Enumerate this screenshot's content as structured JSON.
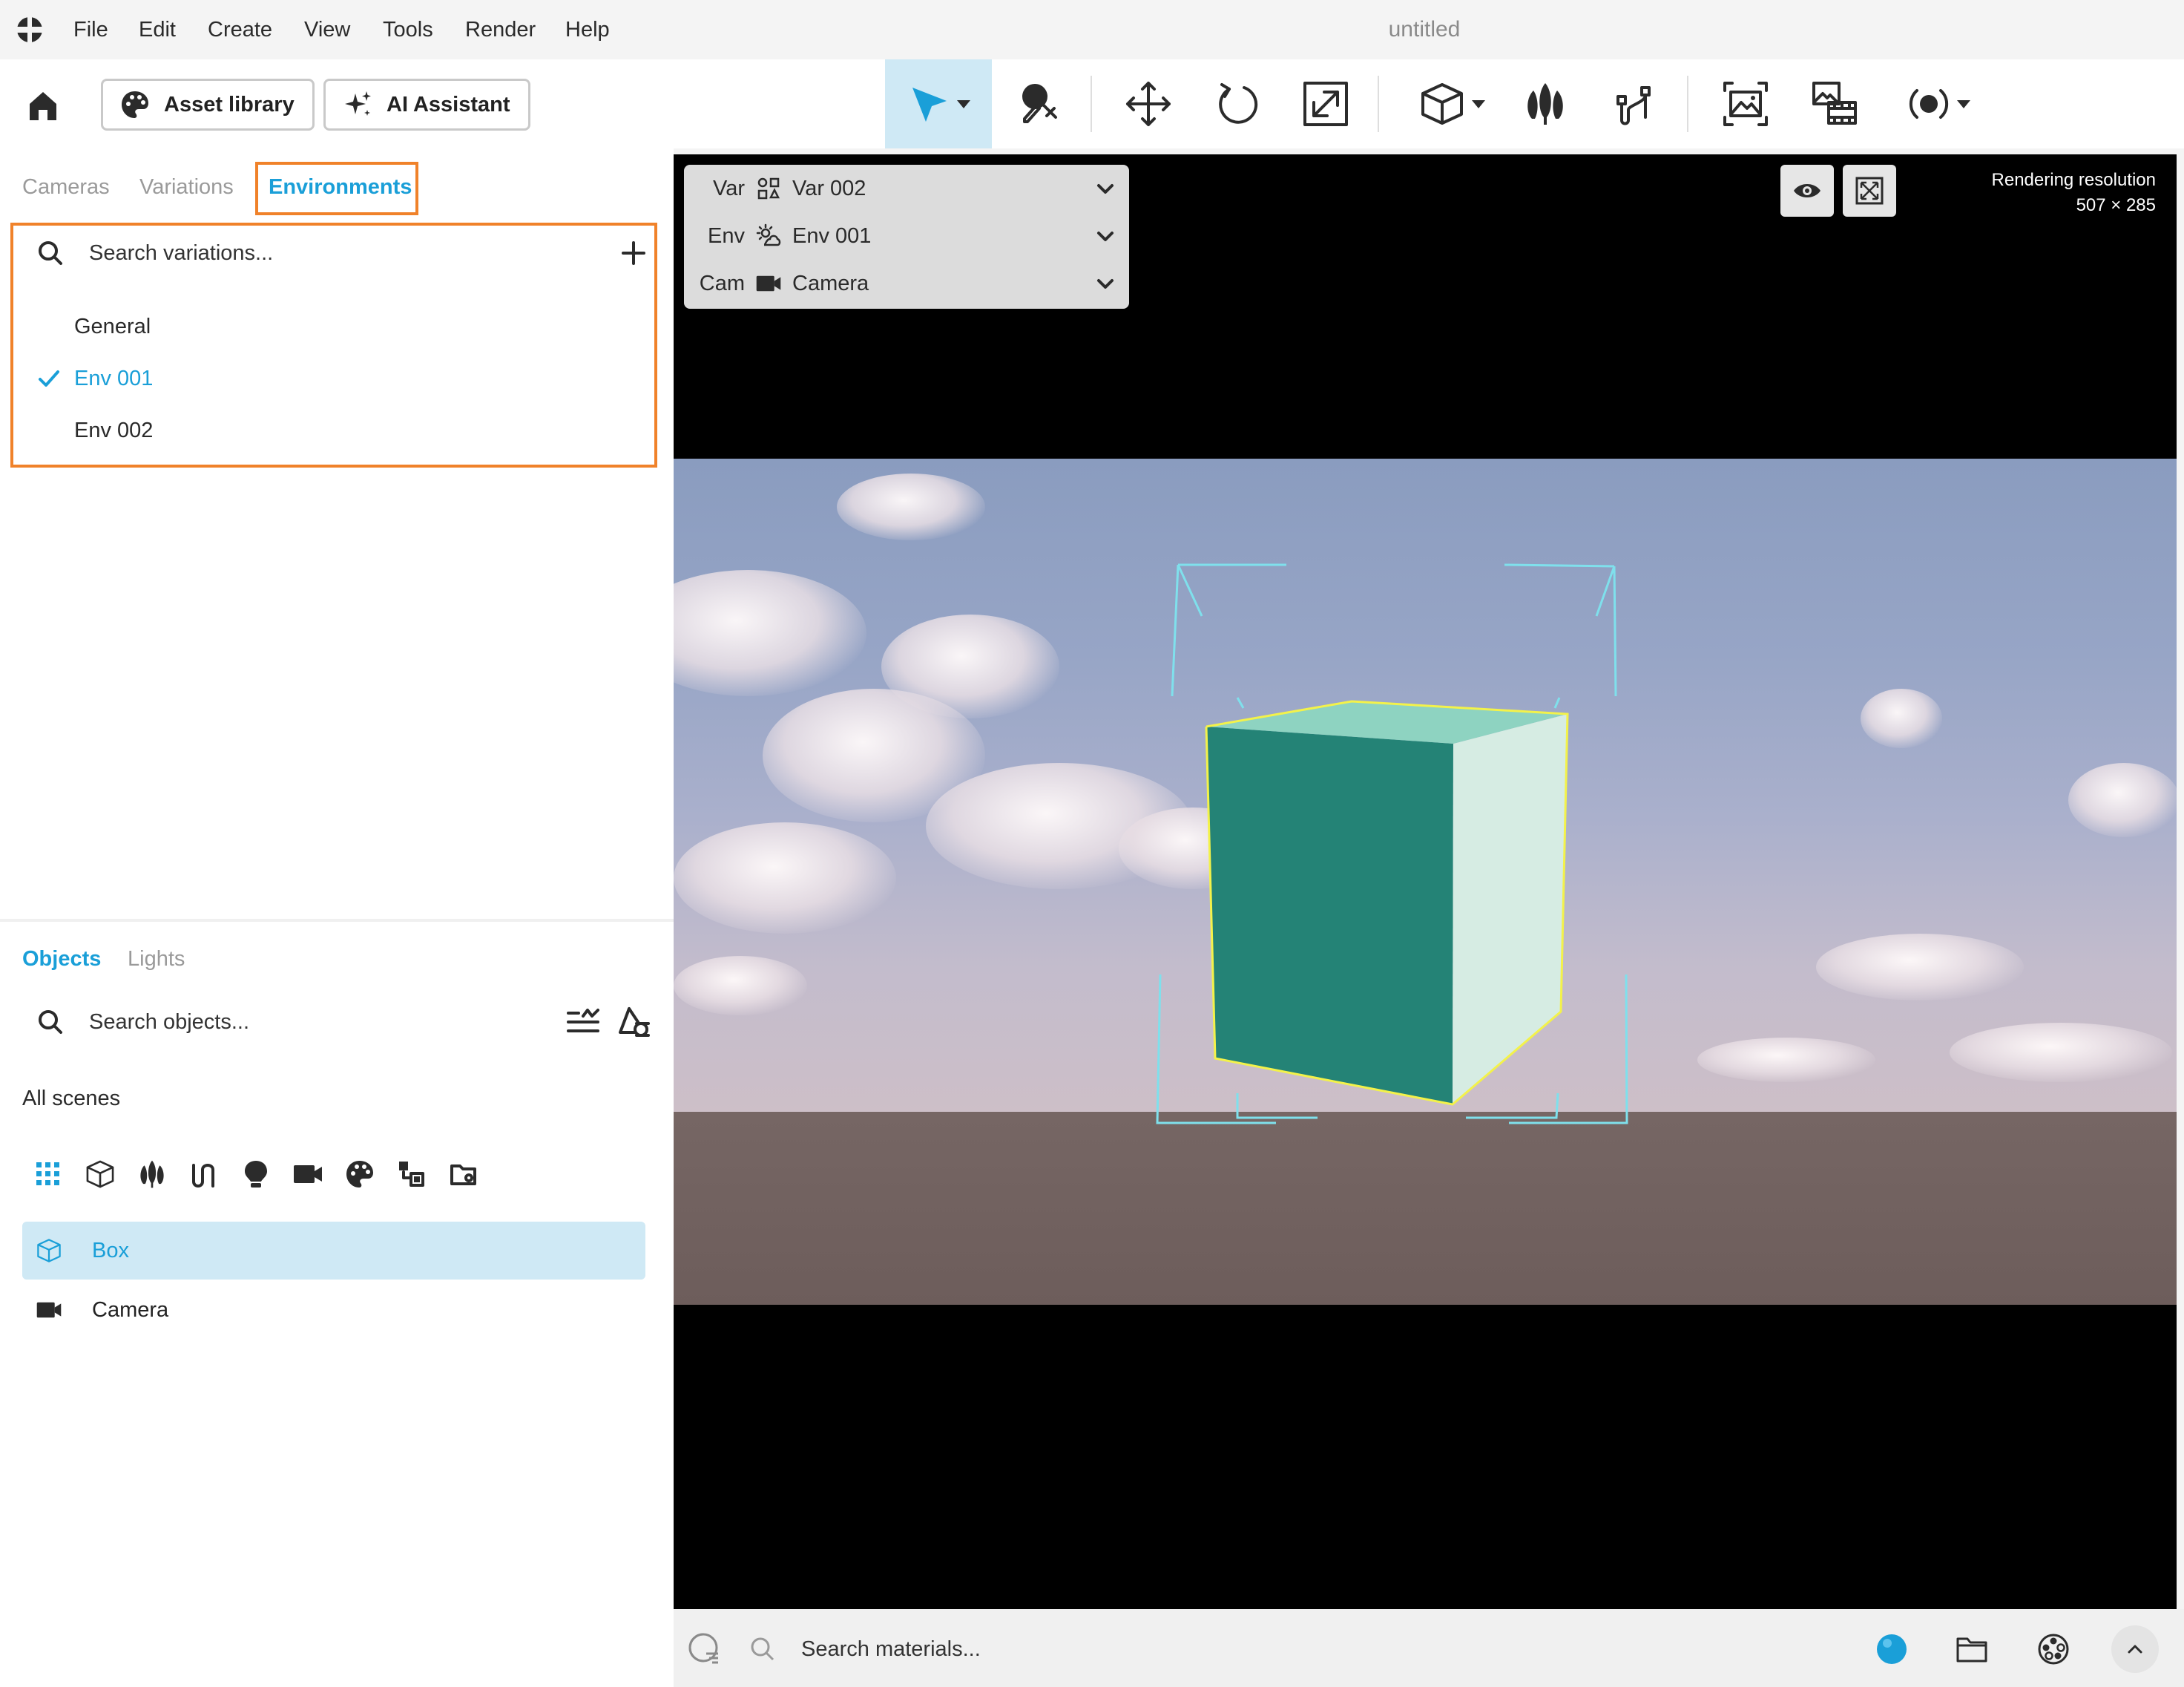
{
  "menubar": {
    "items": [
      "File",
      "Edit",
      "Create",
      "View",
      "Tools",
      "Render",
      "Help"
    ],
    "document_title": "untitled"
  },
  "toolbar": {
    "asset_library_label": "Asset library",
    "ai_assistant_label": "AI Assistant",
    "tools": [
      "select-icon",
      "material-picker-icon",
      "move-icon",
      "rotate-icon",
      "scale-icon",
      "box-icon",
      "plants-icon",
      "curve-icon",
      "render-image-icon",
      "render-animation-icon",
      "live-render-icon"
    ],
    "active_tool": "select"
  },
  "left_panel": {
    "top_tabs": [
      "Cameras",
      "Variations",
      "Environments"
    ],
    "active_top_tab": "Environments",
    "variation_search_placeholder": "Search variations...",
    "variations": [
      {
        "label": "General",
        "selected": false
      },
      {
        "label": "Env 001",
        "selected": true
      },
      {
        "label": "Env 002",
        "selected": false
      }
    ],
    "bottom_tabs": [
      "Objects",
      "Lights"
    ],
    "active_bottom_tab": "Objects",
    "object_search_placeholder": "Search objects...",
    "scene_label": "All scenes",
    "filter_icons": [
      "all-icon",
      "box-icon",
      "plants-icon",
      "curve-icon",
      "light-icon",
      "camera-icon",
      "material-icon",
      "instance-icon",
      "folder-icon"
    ],
    "objects": [
      {
        "label": "Box",
        "icon": "box-icon",
        "selected": true
      },
      {
        "label": "Camera",
        "icon": "camera-icon",
        "selected": false
      }
    ]
  },
  "viewport": {
    "picker": [
      {
        "label": "Var",
        "icon": "variation-icon",
        "value": "Var 002"
      },
      {
        "label": "Env",
        "icon": "environment-icon",
        "value": "Env 001"
      },
      {
        "label": "Cam",
        "icon": "camera-icon",
        "value": "Camera"
      }
    ],
    "render_res_label": "Rendering resolution",
    "render_res_value": "507 × 285"
  },
  "material_bar": {
    "search_placeholder": "Search materials..."
  },
  "colors": {
    "accent": "#1a9fd8",
    "highlight_box": "#f0822a",
    "selected_bg": "#cfe9f5",
    "cube_front": "#248376",
    "cube_side": "#d6ece3",
    "cube_top": "#8ed3c1",
    "selection_outline": "#f3f24a",
    "bounding_guides": "#7fe0ec"
  }
}
